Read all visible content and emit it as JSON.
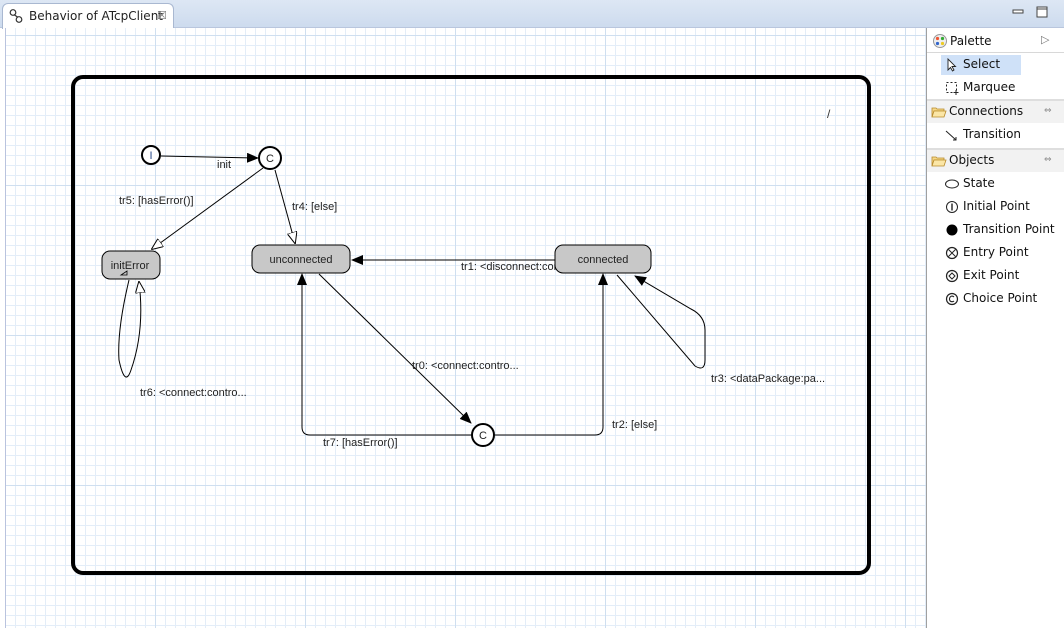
{
  "tab": {
    "title": "Behavior of ATcpClient",
    "close_glyph": "☒"
  },
  "palette": {
    "title": "Palette",
    "collapse_glyph": "▷",
    "tools": [
      {
        "label": "Select",
        "icon": "arrow-cursor-icon",
        "selected": true
      },
      {
        "label": "Marquee",
        "icon": "marquee-icon",
        "selected": false
      }
    ],
    "drawers": [
      {
        "label": "Connections",
        "items": [
          {
            "label": "Transition",
            "icon": "transition-arrow-icon"
          }
        ]
      },
      {
        "label": "Objects",
        "items": [
          {
            "label": "State",
            "icon": "state-icon"
          },
          {
            "label": "Initial Point",
            "icon": "initial-point-icon"
          },
          {
            "label": "Transition Point",
            "icon": "transition-point-icon"
          },
          {
            "label": "Entry Point",
            "icon": "entry-point-icon"
          },
          {
            "label": "Exit Point",
            "icon": "exit-point-icon"
          },
          {
            "label": "Choice Point",
            "icon": "choice-point-icon"
          }
        ]
      }
    ],
    "drawer_toggle_glyph": "⇔"
  },
  "diagram": {
    "graph_label": "/",
    "initial_point_label": "I",
    "choice_label": "C",
    "states": [
      {
        "id": "initError",
        "label": "initError"
      },
      {
        "id": "unconnected",
        "label": "unconnected"
      },
      {
        "id": "connected",
        "label": "connected"
      }
    ],
    "transitions": [
      {
        "id": "init",
        "label": "init"
      },
      {
        "id": "tr5",
        "label": "tr5: [hasError()]"
      },
      {
        "id": "tr4",
        "label": "tr4: [else]"
      },
      {
        "id": "tr1",
        "label": "tr1: <disconnect:con..."
      },
      {
        "id": "tr0",
        "label": "tr0: <connect:contro..."
      },
      {
        "id": "tr3",
        "label": "tr3: <dataPackage:pa..."
      },
      {
        "id": "tr6",
        "label": "tr6: <connect:contro..."
      },
      {
        "id": "tr2",
        "label": "tr2: [else]"
      },
      {
        "id": "tr7",
        "label": "tr7: [hasError()]"
      }
    ],
    "colors": {
      "state_fill": "#c8c8c8",
      "frame": "#000000",
      "grid_minor": "#e3edf8",
      "grid_major": "#cfdff0"
    }
  }
}
